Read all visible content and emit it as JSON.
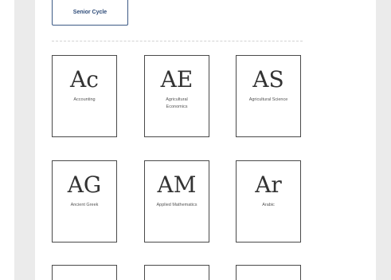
{
  "nav": {
    "senior_cycle_label": "Senior Cycle"
  },
  "subjects": [
    {
      "abbr": "Ac",
      "name": "Accounting"
    },
    {
      "abbr": "AE",
      "name": "Agricultural Economics"
    },
    {
      "abbr": "AS",
      "name": "Agricultural Science"
    },
    {
      "abbr": "AG",
      "name": "Ancient Greek"
    },
    {
      "abbr": "AM",
      "name": "Applied Mathematics"
    },
    {
      "abbr": "Ar",
      "name": "Arabic"
    }
  ]
}
